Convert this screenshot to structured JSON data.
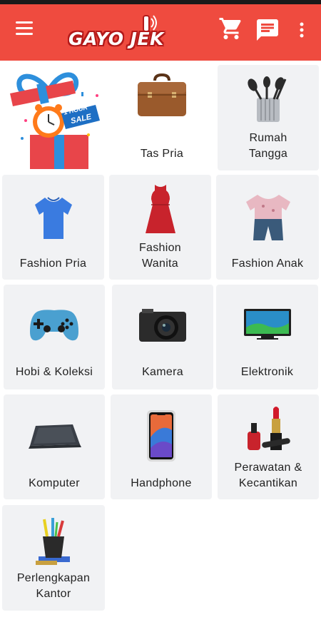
{
  "app": {
    "logo_text": "GAYO JEK"
  },
  "header": {
    "icons": [
      "menu-icon",
      "cart-icon",
      "chat-icon",
      "more-vertical-icon"
    ],
    "color": "#ef4b3f"
  },
  "categories": [
    {
      "label": "1 HOUR SALE",
      "line2": ""
    },
    {
      "label": "Tas Pria",
      "line2": ""
    },
    {
      "label": "Rumah",
      "line2": "Tangga"
    },
    {
      "label": "Fashion Pria",
      "line2": ""
    },
    {
      "label": "Fashion",
      "line2": "Wanita"
    },
    {
      "label": "Fashion Anak",
      "line2": ""
    },
    {
      "label": "Hobi & Koleksi",
      "line2": ""
    },
    {
      "label": "Kamera",
      "line2": ""
    },
    {
      "label": "Elektronik",
      "line2": ""
    },
    {
      "label": "Komputer",
      "line2": ""
    },
    {
      "label": "Handphone",
      "line2": ""
    },
    {
      "label": "Perawatan &",
      "line2": "Kecantikan"
    },
    {
      "label": "Perlengkapan",
      "line2": "Kantor"
    }
  ],
  "promo": {
    "hour_text": "1 HOUR",
    "sale_text": "SALE"
  }
}
